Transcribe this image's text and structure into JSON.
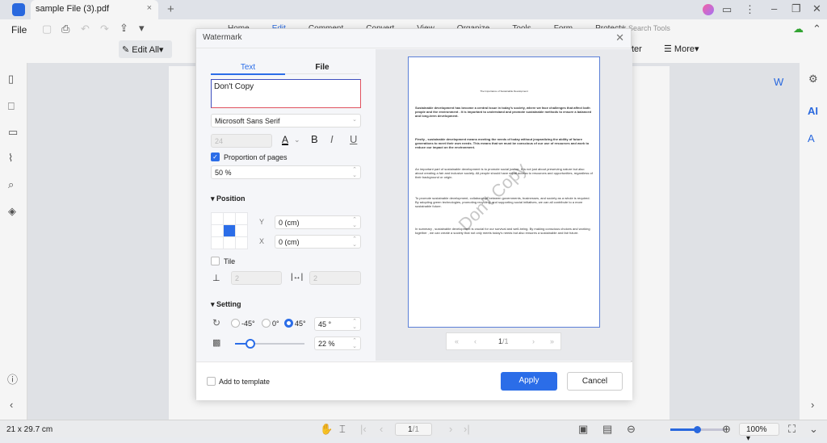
{
  "window": {
    "tab_title": "sample File (3).pdf",
    "close": "×",
    "new_tab": "+"
  },
  "toolbar": {
    "file": "File",
    "edit_all": "Edit All",
    "more": "More",
    "search_tools": "Search Tools",
    "partial_label": "ter",
    "menu_tabs": [
      "Home",
      "Edit",
      "Comment",
      "Convert",
      "View",
      "Organize",
      "Tools",
      "Form",
      "Protect"
    ]
  },
  "status": {
    "page_size": "21 x 29.7 cm",
    "page_indicator": "1",
    "page_total": "/1",
    "zoom": "100%"
  },
  "dialog": {
    "title": "Watermark",
    "tabs": [
      "Text",
      "File"
    ],
    "text_value": "Don't Copy",
    "font": "Microsoft Sans Serif",
    "font_size": "24",
    "proportion_label": "Proportion of pages",
    "proportion_checked": true,
    "proportion_value": "50 %",
    "position_label": "Position",
    "y_label": "Y",
    "y_value": "0 (cm)",
    "x_label": "X",
    "x_value": "0 (cm)",
    "tile_label": "Tile",
    "tile_checked": false,
    "tile_v": "2",
    "tile_h": "2",
    "setting_label": "Setting",
    "rotations": [
      "-45°",
      "0°",
      "45°"
    ],
    "rotation_selected": "45°",
    "rotation_value": "45 °",
    "opacity_value": "22 %",
    "opacity_percent": 22,
    "add_template": "Add to template",
    "apply": "Apply",
    "cancel": "Cancel",
    "preview_page": "1",
    "preview_total": "/1",
    "preview": {
      "title": "The Importance of Sustainable Development",
      "paragraphs": [
        "Sustainable development has become a central issue in today's society, where we face challenges that affect both people and the environment . It is important to understand and promote sustainable methods to ensure a balanced and long-term development.",
        "Firstly , sustainable development means meeting the needs of today without jeopardizing the ability of future generations to meet their own needs. This means that we must be conscious of our use of resources and work to reduce our impact on the environment.",
        "An important part of sustainable development is to promote social justice. It is not just about preserving nature but also about creating a fair and inclusive society. All people should have equal access to resources and opportunities, regardless of their background or origin.",
        "To promote sustainable development, collaboration between governments, businesses, and society as a whole is required. By adopting green technologies, promoting recycling, and supporting social initiatives, we can all contribute to a more sustainable future.",
        "In summary , sustainable development is crucial for our survival and well-being. By making conscious choices and working together , we can create a society that not only meets today's needs but also ensures a sustainable and fair future."
      ],
      "watermark": "Don't Copy"
    }
  },
  "colors": {
    "accent": "#2b6de8",
    "text_border": "#e0525f",
    "slider": "#2b6de8"
  }
}
